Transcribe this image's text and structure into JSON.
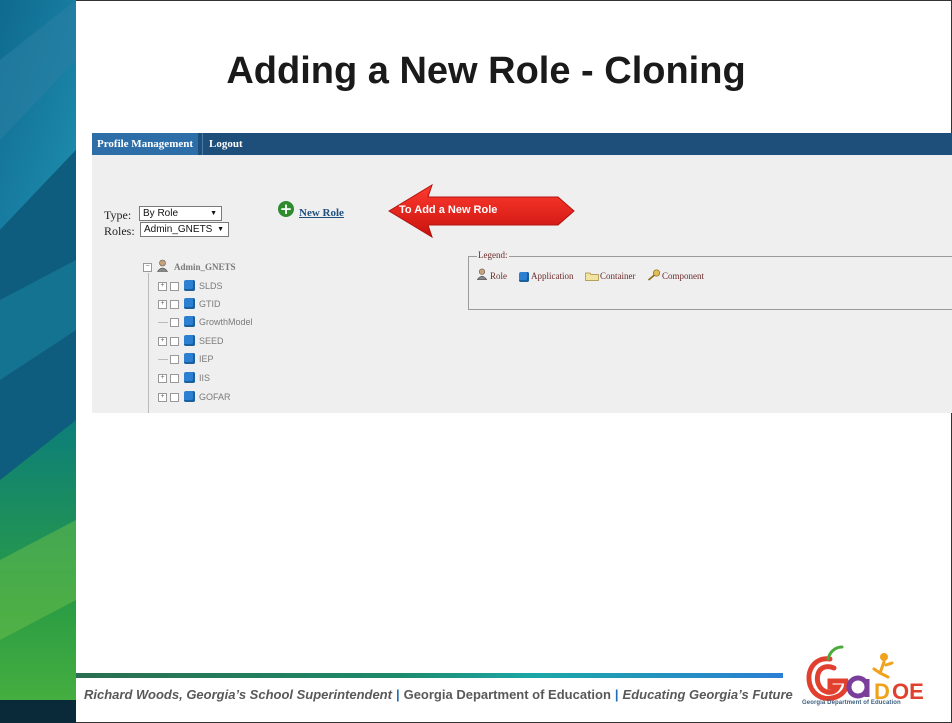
{
  "slide": {
    "title": "Adding a New Role - Cloning",
    "footer": {
      "name": "Richard Woods, Georgia’s School Superintendent",
      "separator": "|",
      "org": "Georgia Department of Education",
      "tagline": "Educating Georgia’s Future"
    },
    "logo": {
      "text": "GaDOE",
      "subtext": "Georgia Department of Education"
    }
  },
  "app": {
    "nav": {
      "items": [
        {
          "label": "Profile Management",
          "active": true
        },
        {
          "label": "Logout",
          "active": false
        }
      ]
    },
    "filters": {
      "type_label": "Type:",
      "type_value": "By Role",
      "roles_label": "Roles:",
      "roles_value": "Admin_GNETS"
    },
    "new_role_link": "New Role",
    "callout": "To Add a New Role",
    "tree": {
      "root": "Admin_GNETS",
      "children": [
        "SLDS",
        "GTID",
        "GrowthModel",
        "SEED",
        "IEP",
        "IIS",
        "GOFAR"
      ]
    },
    "legend": {
      "title": "Legend:",
      "items": [
        {
          "label": "Role",
          "icon": "role-icon"
        },
        {
          "label": "Application",
          "icon": "application-icon"
        },
        {
          "label": "Container",
          "icon": "folder-icon"
        },
        {
          "label": "Component",
          "icon": "key-icon"
        }
      ]
    }
  },
  "colors": {
    "nav_bg": "#1e4e7a",
    "nav_active": "#2d6ea8",
    "callout_red": "#e8231f",
    "footer_green": "#2a6f4f",
    "footer_teal": "#1ba7a7",
    "footer_blue": "#2b7fd4"
  }
}
